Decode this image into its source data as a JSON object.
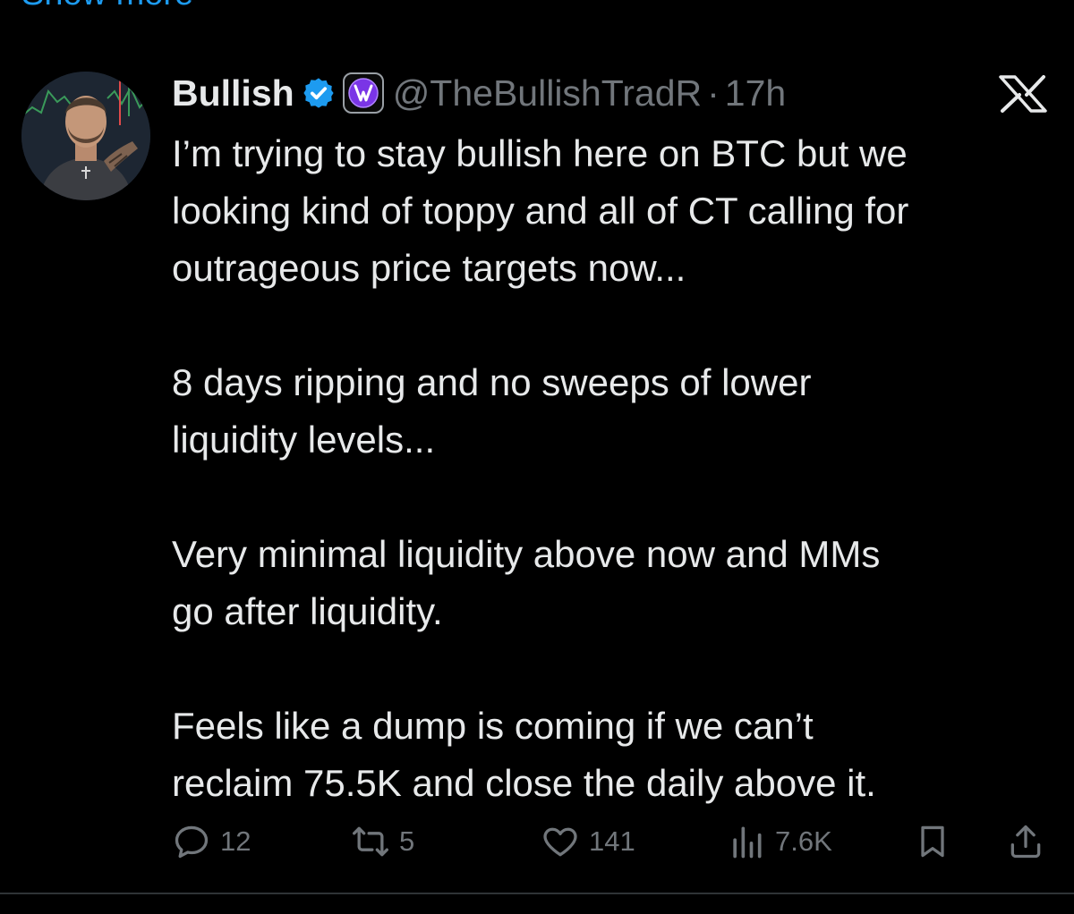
{
  "top": {
    "show_more": "Show more"
  },
  "tweet": {
    "author": {
      "display_name": "Bullish",
      "handle": "@TheBullishTradR",
      "separator": "·",
      "time": "17h"
    },
    "paragraphs": [
      "I’m trying to stay bullish here on BTC but we\nlooking kind of toppy and all of CT calling for\noutrageous price targets now...",
      "8 days ripping and no sweeps of lower\nliquidity levels...",
      "Very minimal liquidity above now and MMs\ngo after liquidity.",
      "Feels like a dump is coming if we can’t\nreclaim 75.5K and close the daily above it."
    ],
    "actions": {
      "replies": "12",
      "reposts": "5",
      "likes": "141",
      "views": "7.6K"
    }
  },
  "icons": {
    "verified": "verified-badge-icon",
    "affiliate": "affiliate-badge-icon",
    "platform": "x-logo-icon",
    "reply": "reply-icon",
    "repost": "repost-icon",
    "like": "heart-icon",
    "views": "views-icon",
    "bookmark": "bookmark-icon",
    "share": "share-icon"
  },
  "colors": {
    "background": "#000000",
    "text_primary": "#e7e9ea",
    "text_secondary": "#71767b",
    "accent": "#1d9bf0",
    "affiliate_purple": "#8b3ff2"
  }
}
